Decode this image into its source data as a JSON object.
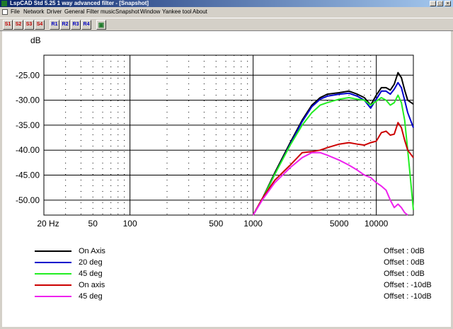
{
  "window": {
    "title": "LspCAD Std 5.25 1 way advanced filter - [Snapshot]",
    "buttons": [
      "_",
      "□",
      "×"
    ]
  },
  "menu": [
    "File",
    "Network",
    "Driver",
    "General",
    "Filter music",
    "Snapshot",
    "Window",
    "Yankee tool",
    "About"
  ],
  "toolbar": {
    "snapshot_buttons": [
      "S1",
      "S2",
      "S3",
      "S4"
    ],
    "recall_buttons": [
      "R1",
      "R2",
      "R3",
      "R4"
    ],
    "snapshot_icon": "camera-icon"
  },
  "chart_data": {
    "type": "line",
    "ylabel": "dB",
    "xscale": "log",
    "xlim": [
      20,
      20000
    ],
    "ylim": [
      -53,
      -21
    ],
    "yticks": [
      -25,
      -30,
      -35,
      -40,
      -45,
      -50
    ],
    "ytick_labels": [
      "-25.00",
      "-30.00",
      "-35.00",
      "-40.00",
      "-45.00",
      "-50.00"
    ],
    "xtick_labels": [
      {
        "x": 20,
        "label": "20 Hz"
      },
      {
        "x": 50,
        "label": "50"
      },
      {
        "x": 100,
        "label": "100"
      },
      {
        "x": 500,
        "label": "500"
      },
      {
        "x": 1000,
        "label": "1000"
      },
      {
        "x": 5000,
        "label": "5000"
      },
      {
        "x": 10000,
        "label": "10000"
      }
    ],
    "grid": true,
    "series": [
      {
        "name": "On Axis",
        "offset": "Offset : 0dB",
        "color": "#000000",
        "points": [
          [
            1000,
            -53
          ],
          [
            1200,
            -49.5
          ],
          [
            1500,
            -44.5
          ],
          [
            2000,
            -38.5
          ],
          [
            2500,
            -34
          ],
          [
            3000,
            -31
          ],
          [
            3500,
            -29.5
          ],
          [
            4000,
            -28.8
          ],
          [
            5000,
            -28.5
          ],
          [
            6000,
            -28.2
          ],
          [
            7000,
            -28.8
          ],
          [
            8000,
            -29.5
          ],
          [
            9000,
            -31
          ],
          [
            10000,
            -29
          ],
          [
            11000,
            -27.5
          ],
          [
            12000,
            -27.5
          ],
          [
            13000,
            -28
          ],
          [
            14000,
            -26.8
          ],
          [
            15000,
            -24.5
          ],
          [
            16000,
            -25.5
          ],
          [
            17000,
            -28
          ],
          [
            18000,
            -30
          ],
          [
            20000,
            -30.8
          ]
        ]
      },
      {
        "name": "20 deg",
        "offset": "Offset : 0dB",
        "color": "#0000cc",
        "points": [
          [
            1000,
            -53
          ],
          [
            1200,
            -49.7
          ],
          [
            1500,
            -44.8
          ],
          [
            2000,
            -38.8
          ],
          [
            2500,
            -34.3
          ],
          [
            3000,
            -31.3
          ],
          [
            3500,
            -29.8
          ],
          [
            4000,
            -29.2
          ],
          [
            5000,
            -28.8
          ],
          [
            6000,
            -28.6
          ],
          [
            7000,
            -29.2
          ],
          [
            8000,
            -30
          ],
          [
            9000,
            -31.6
          ],
          [
            10000,
            -29.8
          ],
          [
            11000,
            -28.2
          ],
          [
            12000,
            -28.2
          ],
          [
            13000,
            -28.8
          ],
          [
            14000,
            -27.8
          ],
          [
            15000,
            -26.5
          ],
          [
            16000,
            -27.5
          ],
          [
            17000,
            -30
          ],
          [
            18000,
            -32.5
          ],
          [
            20000,
            -35.5
          ]
        ]
      },
      {
        "name": "45 deg",
        "offset": "Offset : 0dB",
        "color": "#22ee22",
        "points": [
          [
            1000,
            -53
          ],
          [
            1200,
            -49.6
          ],
          [
            1500,
            -44.8
          ],
          [
            2000,
            -39
          ],
          [
            2500,
            -35
          ],
          [
            3000,
            -32.5
          ],
          [
            3500,
            -31
          ],
          [
            4000,
            -30.5
          ],
          [
            5000,
            -29.8
          ],
          [
            6000,
            -29.5
          ],
          [
            7000,
            -29.8
          ],
          [
            8000,
            -30
          ],
          [
            9000,
            -31
          ],
          [
            10000,
            -30.2
          ],
          [
            11000,
            -29.5
          ],
          [
            12000,
            -30
          ],
          [
            13000,
            -31
          ],
          [
            14000,
            -30.5
          ],
          [
            15000,
            -29
          ],
          [
            16000,
            -30.5
          ],
          [
            17000,
            -34
          ],
          [
            18000,
            -40
          ],
          [
            19000,
            -46
          ],
          [
            20000,
            -52
          ]
        ]
      },
      {
        "name": "On axis",
        "offset": "Offset : -10dB",
        "color": "#cc0000",
        "points": [
          [
            1000,
            -53
          ],
          [
            1200,
            -49.5
          ],
          [
            1500,
            -46
          ],
          [
            2000,
            -43
          ],
          [
            2500,
            -40.5
          ],
          [
            3000,
            -40.3
          ],
          [
            3500,
            -40
          ],
          [
            4000,
            -39.5
          ],
          [
            5000,
            -38.8
          ],
          [
            6000,
            -38.5
          ],
          [
            7000,
            -38.8
          ],
          [
            8000,
            -39
          ],
          [
            9000,
            -38.5
          ],
          [
            10000,
            -38.2
          ],
          [
            11000,
            -36.5
          ],
          [
            12000,
            -36.2
          ],
          [
            13000,
            -37
          ],
          [
            14000,
            -36.8
          ],
          [
            15000,
            -34.5
          ],
          [
            16000,
            -35.5
          ],
          [
            17000,
            -38
          ],
          [
            18000,
            -40
          ],
          [
            20000,
            -41.5
          ]
        ]
      },
      {
        "name": "45 deg",
        "offset": "Offset : -10dB",
        "color": "#ee22ee",
        "points": [
          [
            1000,
            -53
          ],
          [
            1200,
            -49.8
          ],
          [
            1500,
            -46.5
          ],
          [
            2000,
            -43.5
          ],
          [
            2500,
            -41.5
          ],
          [
            3000,
            -40.5
          ],
          [
            3500,
            -40.5
          ],
          [
            4000,
            -41
          ],
          [
            5000,
            -42
          ],
          [
            6000,
            -43
          ],
          [
            7000,
            -44
          ],
          [
            8000,
            -45
          ],
          [
            9000,
            -45.5
          ],
          [
            10000,
            -46.5
          ],
          [
            11000,
            -47.2
          ],
          [
            12000,
            -48
          ],
          [
            13000,
            -50
          ],
          [
            14000,
            -51.5
          ],
          [
            15000,
            -50.8
          ],
          [
            16000,
            -51.5
          ],
          [
            17000,
            -52.5
          ],
          [
            18000,
            -53
          ]
        ]
      }
    ]
  }
}
